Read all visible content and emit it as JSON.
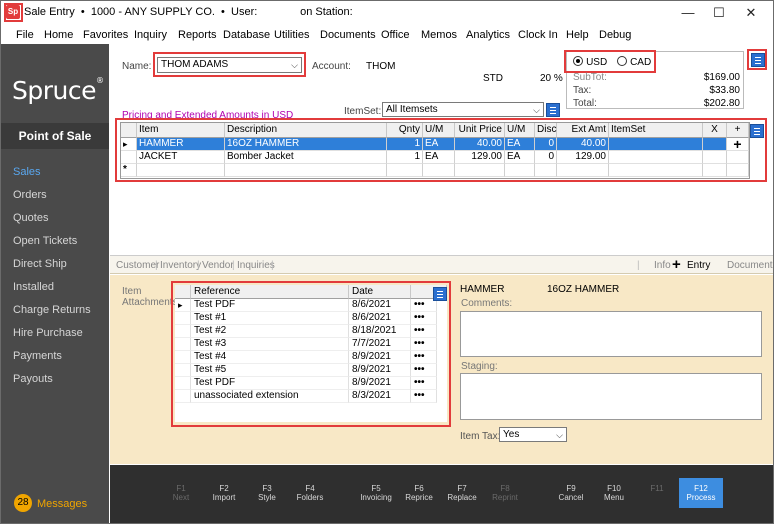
{
  "window": {
    "title": "Sale Entry  •  1000 - ANY SUPPLY CO.  •  User:              on Station:",
    "app_icon_label": "Sp",
    "controls": {
      "minimize": "—",
      "maximize": "☐",
      "close": "✕"
    }
  },
  "menu": [
    "File",
    "Home",
    "Favorites",
    "Inquiry",
    "Reports",
    "Database",
    "Utilities",
    "Documents",
    "Office",
    "Memos",
    "Analytics",
    "Clock In",
    "Help",
    "Debug"
  ],
  "sidebar": {
    "logo": "Spruce",
    "logo_mark": "®",
    "section": "Point of Sale",
    "items": [
      "Sales",
      "Orders",
      "Quotes",
      "Open Tickets",
      "Direct Ship",
      "Installed",
      "Charge Returns",
      "Hire Purchase",
      "Payments",
      "Payouts"
    ],
    "active_index": 0,
    "messages_count": "28",
    "messages_label": "Messages"
  },
  "header": {
    "name_label": "Name:",
    "name_value": "THOM ADAMS",
    "account_label": "Account:",
    "account_value": "THOM",
    "std_label": "STD",
    "std_pct": "20 %",
    "pricing_note": "Pricing and Extended Amounts in USD",
    "itemset_label": "ItemSet:",
    "itemset_value": "All Itemsets"
  },
  "currency": {
    "options": [
      "USD",
      "CAD"
    ],
    "selected": "USD"
  },
  "totals": {
    "subtotal_label": "SubTot:",
    "subtotal_value": "$169.00",
    "tax_label": "Tax:",
    "tax_value": "$33.80",
    "total_label": "Total:",
    "total_value": "$202.80"
  },
  "items_grid": {
    "columns": [
      "Item",
      "Description",
      "Qnty",
      "U/M",
      "Unit Price",
      "U/M",
      "Disc",
      "Ext Amt",
      "ItemSet",
      "X",
      "+"
    ],
    "rows": [
      {
        "item": "HAMMER",
        "description": "16OZ HAMMER",
        "qnty": "1",
        "um": "EA",
        "unit_price": "40.00",
        "um2": "EA",
        "disc": "0",
        "ext_amt": "40.00"
      },
      {
        "item": "JACKET",
        "description": "Bomber Jacket",
        "qnty": "1",
        "um": "EA",
        "unit_price": "129.00",
        "um2": "EA",
        "disc": "0",
        "ext_amt": "129.00"
      }
    ],
    "new_row_marker": "*",
    "current_row_marker": "▸",
    "add_glyph": "+"
  },
  "tabs_left": [
    "Customer",
    "Inventory",
    "Vendor",
    "Inquiries"
  ],
  "tabs_right": [
    "Info",
    "Entry",
    "Document"
  ],
  "tabs_active": "Entry",
  "tabs_separator": "|",
  "attachments": {
    "label": "Item Attachments",
    "columns": [
      "Reference",
      "Date"
    ],
    "rows": [
      {
        "reference": "Test PDF",
        "date": "8/6/2021"
      },
      {
        "reference": "Test #1",
        "date": "8/6/2021"
      },
      {
        "reference": "Test #2",
        "date": "8/18/2021"
      },
      {
        "reference": "Test #3",
        "date": "7/7/2021"
      },
      {
        "reference": "Test #4",
        "date": "8/9/2021"
      },
      {
        "reference": "Test #5",
        "date": "8/9/2021"
      },
      {
        "reference": "Test PDF",
        "date": "8/9/2021"
      },
      {
        "reference": "unassociated extension",
        "date": "8/3/2021"
      }
    ],
    "more_glyph": "•••"
  },
  "detail": {
    "item_code": "HAMMER",
    "item_desc": "16OZ HAMMER",
    "comments_label": "Comments:",
    "staging_label": "Staging:",
    "item_tax_label": "Item Tax:",
    "item_tax_value": "Yes"
  },
  "fkeys": [
    {
      "key": "F1",
      "label": "Next",
      "enabled": false
    },
    {
      "key": "F2",
      "label": "Import",
      "enabled": true
    },
    {
      "key": "F3",
      "label": "Style",
      "enabled": true
    },
    {
      "key": "F4",
      "label": "Folders",
      "enabled": true
    },
    {
      "key": "F5",
      "label": "Invoicing",
      "enabled": true
    },
    {
      "key": "F6",
      "label": "Reprice",
      "enabled": true
    },
    {
      "key": "F7",
      "label": "Replace",
      "enabled": true
    },
    {
      "key": "F8",
      "label": "Reprint",
      "enabled": false
    },
    {
      "key": "F9",
      "label": "Cancel",
      "enabled": true
    },
    {
      "key": "F10",
      "label": "Menu",
      "enabled": true
    },
    {
      "key": "F11",
      "label": "",
      "enabled": false
    },
    {
      "key": "F12",
      "label": "Process",
      "enabled": true
    }
  ],
  "colors": {
    "accent": "#2e7fd9",
    "highlight": "#e23b3b",
    "panel": "#f8e8c6",
    "sidebar": "#4a4a4a",
    "messages": "#f0a500"
  }
}
